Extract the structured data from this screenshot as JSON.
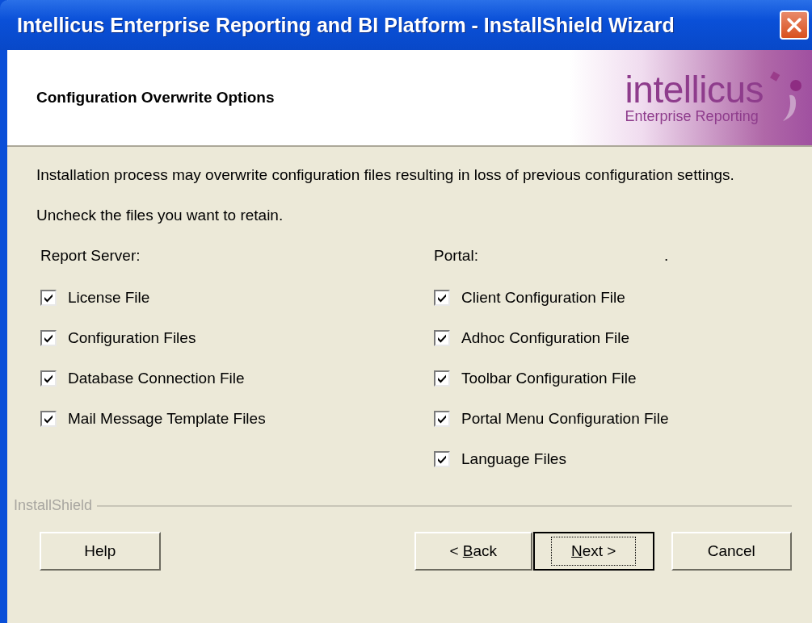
{
  "window": {
    "title": "Intellicus Enterprise Reporting and BI Platform - InstallShield Wizard"
  },
  "header": {
    "title": "Configuration Overwrite Options",
    "logo": {
      "name": "intellicus",
      "tagline": "Enterprise Reporting"
    }
  },
  "body": {
    "description": "Installation process may overwrite configuration files resulting in loss of previous configuration settings.",
    "instruction": "Uncheck the files you want to retain."
  },
  "groups": [
    {
      "label": "Report Server:",
      "items": [
        {
          "label": "License File",
          "checked": true
        },
        {
          "label": "Configuration Files",
          "checked": true
        },
        {
          "label": "Database Connection File",
          "checked": true
        },
        {
          "label": "Mail Message Template Files",
          "checked": true
        }
      ]
    },
    {
      "label": "Portal:",
      "mark": ".",
      "items": [
        {
          "label": "Client Configuration File",
          "checked": true
        },
        {
          "label": "Adhoc Configuration File",
          "checked": true
        },
        {
          "label": "Toolbar Configuration File",
          "checked": true
        },
        {
          "label": "Portal Menu Configuration File",
          "checked": true
        },
        {
          "label": "Language Files",
          "checked": true
        }
      ]
    }
  ],
  "footer": {
    "brand": "InstallShield"
  },
  "buttons": [
    {
      "label": "Help",
      "default": false
    },
    {
      "prefix": "< ",
      "access_key": "B",
      "rest": "ack",
      "default": false
    },
    {
      "access_key": "N",
      "rest": "ext >",
      "default": true
    },
    {
      "label": "Cancel",
      "default": false
    }
  ]
}
